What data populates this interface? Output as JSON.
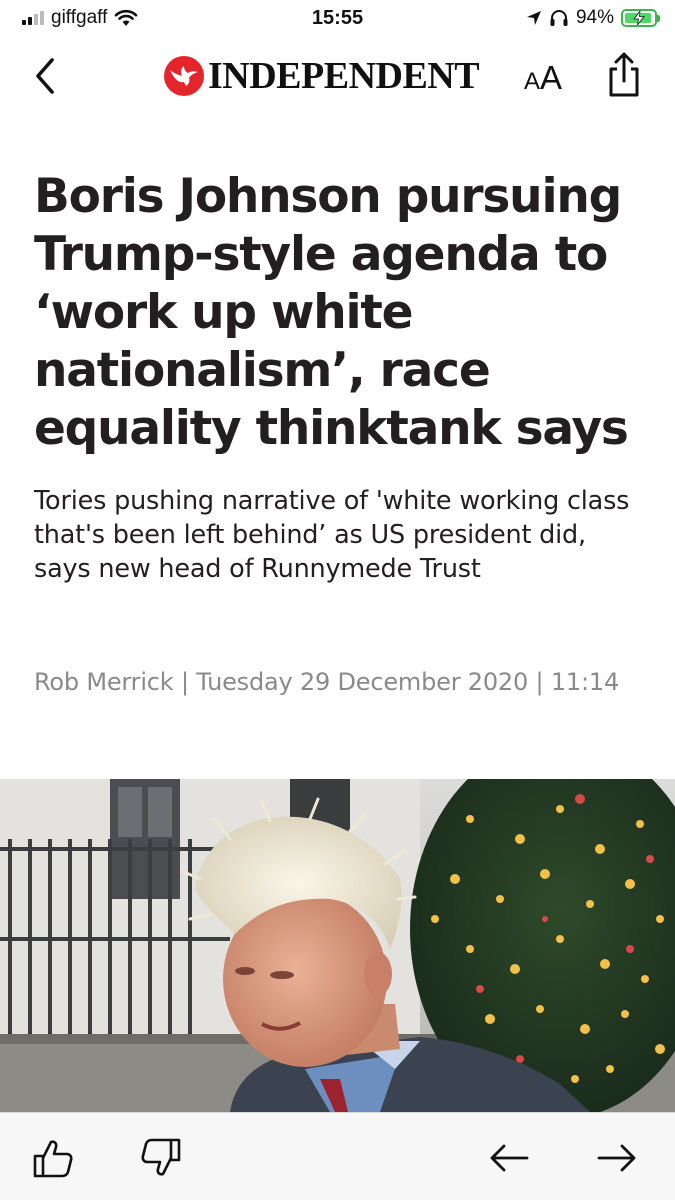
{
  "status_bar": {
    "carrier": "giffgaff",
    "time": "15:55",
    "battery_percent": "94%",
    "battery_level": 0.94,
    "battery_color": "#4cd964",
    "icons": [
      "signal-icon",
      "wifi-icon",
      "location-arrow-icon",
      "headphones-icon",
      "battery-charging-icon"
    ]
  },
  "nav": {
    "back_icon": "chevron-left-icon",
    "logo_text": "INDEPENDENT",
    "logo_icon": "eagle-icon",
    "logo_color": "#e4252b",
    "text_size_small": "A",
    "text_size_large": "A",
    "share_icon": "share-icon"
  },
  "article": {
    "headline": "Boris Johnson pursuing Trump-style agenda to ‘work up white nationalism’, race equality thinktank says",
    "standfirst": "Tories pushing narrative of 'white working class that's been left behind’ as US president did, says new head of Runnymede Trust",
    "author": "Rob Merrick",
    "separator": "|",
    "date": "Tuesday 29 December 2020",
    "time": "11:14"
  },
  "toolbar": {
    "icons": [
      "thumbs-up-icon",
      "thumbs-down-icon",
      "arrow-left-icon",
      "arrow-right-icon"
    ]
  }
}
